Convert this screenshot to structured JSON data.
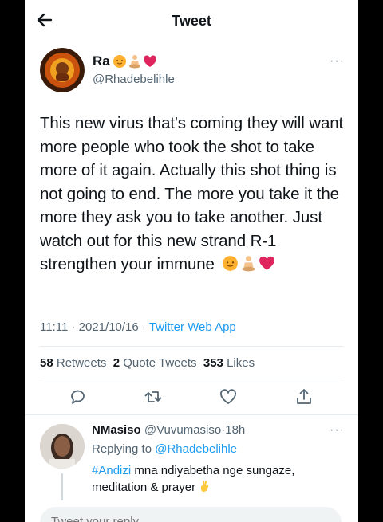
{
  "header": {
    "title": "Tweet",
    "back_icon": "arrow-left-icon"
  },
  "tweet": {
    "name": "Ra",
    "name_emojis": [
      "sun-face-emoji",
      "meditating-person-emoji",
      "red-heart-emoji"
    ],
    "handle": "@Rhadebelihle",
    "text": "This new virus that's coming they will want more people who took the shot to take more of it again. Actually this shot thing is not going to end. The more you take it the more they ask you to take another. Just watch out for this new strand R-1 strengthen your immune",
    "text_emojis": [
      "sun-face-emoji",
      "meditating-person-emoji",
      "red-heart-emoji"
    ],
    "time": "11:11",
    "date": "2021/10/16",
    "source": "Twitter Web App",
    "retweets_count": "58",
    "retweets_label": "Retweets",
    "quotes_count": "2",
    "quotes_label": "Quote Tweets",
    "likes_count": "353",
    "likes_label": "Likes"
  },
  "reply": {
    "name": "NMasiso",
    "handle": "@Vuvumasiso",
    "time": "18h",
    "replying_label": "Replying to",
    "replying_to": "@Rhadebelihle",
    "hashtag": "#Andizi",
    "text": "mna ndiyabetha nge sungaze, meditation & prayer",
    "emoji": "crossed-fingers-emoji"
  },
  "compose": {
    "placeholder": "Tweet your reply"
  },
  "colors": {
    "accent": "#1d9bf0",
    "text": "#0f1419",
    "secondary": "#536471",
    "heart": "#e0245e"
  }
}
